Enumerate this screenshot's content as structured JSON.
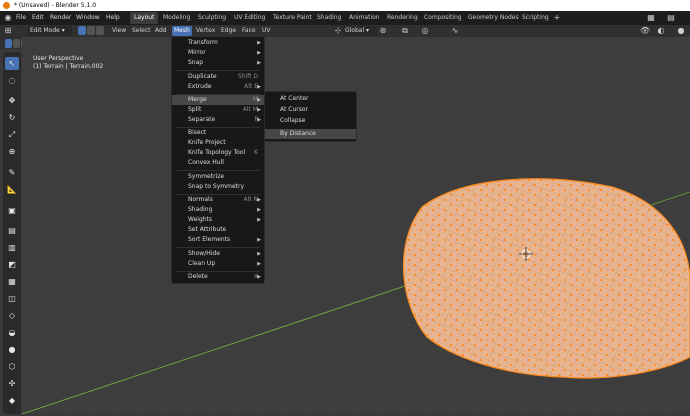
{
  "window": {
    "title": "* (Unsaved) - Blender 5.1.0"
  },
  "top_menu": [
    "File",
    "Edit",
    "Render",
    "Window",
    "Help"
  ],
  "workspaces": {
    "tabs": [
      "Layout",
      "Modeling",
      "Sculpting",
      "UV Editing",
      "Texture Paint",
      "Shading",
      "Animation",
      "Rendering",
      "Compositing",
      "Geometry Nodes",
      "Scripting"
    ],
    "active": "Layout"
  },
  "header": {
    "mode": "Edit Mode",
    "menus": [
      "View",
      "Select",
      "Add",
      "Mesh",
      "Vertex",
      "Edge",
      "Face",
      "UV"
    ],
    "open_menu": "Mesh",
    "transform_orientation": "Global"
  },
  "viewport": {
    "perspective_label": "User Perspective",
    "object_label": "(1) Terrain | Terrain.002"
  },
  "mesh_menu": {
    "items": [
      {
        "label": "Transform",
        "submenu": true
      },
      {
        "label": "Mirror",
        "submenu": true
      },
      {
        "label": "Snap",
        "submenu": true
      },
      {
        "label": "Duplicate",
        "shortcut": "Shift D"
      },
      {
        "label": "Extrude",
        "shortcut": "Alt E"
      },
      {
        "label": "Merge",
        "shortcut": "M",
        "submenu": true,
        "highlighted": true
      },
      {
        "label": "Split",
        "shortcut": "Alt M"
      },
      {
        "label": "Separate",
        "shortcut": "P"
      },
      {
        "label": "Bisect"
      },
      {
        "label": "Knife Project"
      },
      {
        "label": "Knife Topology Tool",
        "shortcut": "K"
      },
      {
        "label": "Convex Hull"
      },
      {
        "label": "Symmetrize"
      },
      {
        "label": "Snap to Symmetry"
      },
      {
        "label": "Normals",
        "shortcut": "Alt N"
      },
      {
        "label": "Shading",
        "submenu": true
      },
      {
        "label": "Weights",
        "submenu": true
      },
      {
        "label": "Set Attribute"
      },
      {
        "label": "Sort Elements",
        "submenu": true
      },
      {
        "label": "Show/Hide",
        "submenu": true
      },
      {
        "label": "Clean Up",
        "submenu": true
      },
      {
        "label": "Delete",
        "shortcut": "X"
      }
    ]
  },
  "merge_submenu": {
    "items": [
      {
        "label": "At Center"
      },
      {
        "label": "At Cursor"
      },
      {
        "label": "Collapse"
      },
      {
        "label": "By Distance",
        "highlighted": true
      }
    ]
  },
  "colors": {
    "accent": "#4772b3",
    "mesh_face": "#e8b48f",
    "vertex": "#ff8a1a",
    "menu_bg": "#181818"
  }
}
